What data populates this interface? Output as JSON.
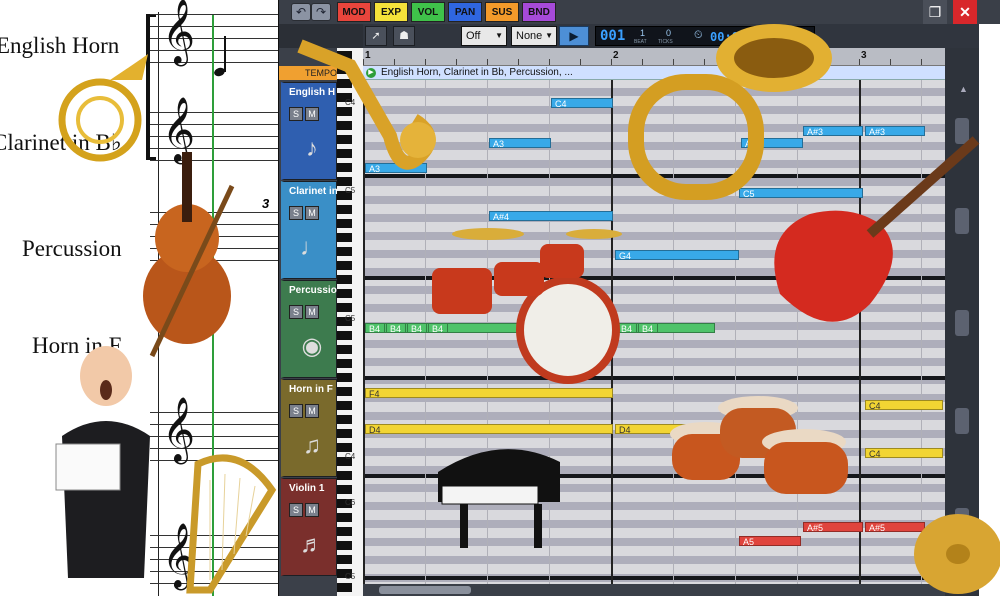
{
  "score": {
    "labels": [
      "English Horn",
      "Clarinet in B♭",
      "Percussion",
      "Horn in F"
    ],
    "tuplet": "3"
  },
  "window": {
    "lane_tabs": [
      {
        "label": "MOD",
        "color": "#e8453c"
      },
      {
        "label": "EXP",
        "color": "#f5e23a"
      },
      {
        "label": "VOL",
        "color": "#3fc24a"
      },
      {
        "label": "PAN",
        "color": "#2f66e0"
      },
      {
        "label": "SUS",
        "color": "#f39a2a"
      },
      {
        "label": "BND",
        "color": "#a64ad9"
      }
    ],
    "undo_icons": [
      "undo-icon",
      "redo-icon"
    ],
    "close_label": "✕"
  },
  "toolbar": {
    "snap_value": "Off",
    "quantize_value": "None",
    "counter": {
      "bar": "001",
      "beat": "1",
      "ticks": "0",
      "beat_caption": "BEAT",
      "ticks_caption": "TICKS",
      "time": "00:00",
      "tempo_tail": "0"
    }
  },
  "tempo_label": "TEMPO",
  "tracks": [
    {
      "name": "English H",
      "color": "#2f5fb0",
      "solo": "S",
      "mute": "M"
    },
    {
      "name": "Clarinet in",
      "color": "#3a8fc7",
      "solo": "S",
      "mute": "M"
    },
    {
      "name": "Percussion",
      "color": "#3d7b4e",
      "solo": "S",
      "mute": "M"
    },
    {
      "name": "Horn in F",
      "color": "#7a6a2c",
      "solo": "S",
      "mute": "M"
    },
    {
      "name": "Violin 1",
      "color": "#7a2f2c",
      "solo": "S",
      "mute": "M"
    }
  ],
  "keyboard_labels": [
    "C4",
    "C5",
    "C5",
    "C4",
    "C6",
    "C5"
  ],
  "ruler": {
    "marks": [
      "1",
      "2",
      "3"
    ]
  },
  "region_title": "English Horn, Clarinet in Bb, Percussion, ...",
  "notes": [
    {
      "label": "C4",
      "color": "blue"
    },
    {
      "label": "A3",
      "color": "blue"
    },
    {
      "label": "A3",
      "color": "blue"
    },
    {
      "label": "A#3",
      "color": "blue"
    },
    {
      "label": "A#3",
      "color": "blue"
    },
    {
      "label": "A3",
      "color": "blue"
    },
    {
      "label": "C5",
      "color": "blue"
    },
    {
      "label": "A#4",
      "color": "blue"
    },
    {
      "label": "G4",
      "color": "blue"
    },
    {
      "label": "B4",
      "color": "green"
    },
    {
      "label": "F4",
      "color": "yellow"
    },
    {
      "label": "D4",
      "color": "yellow"
    },
    {
      "label": "D4",
      "color": "yellow"
    },
    {
      "label": "C4",
      "color": "yellow"
    },
    {
      "label": "C4",
      "color": "yellow"
    },
    {
      "label": "A5",
      "color": "red"
    },
    {
      "label": "A#5",
      "color": "red"
    },
    {
      "label": "A#5",
      "color": "red"
    }
  ]
}
